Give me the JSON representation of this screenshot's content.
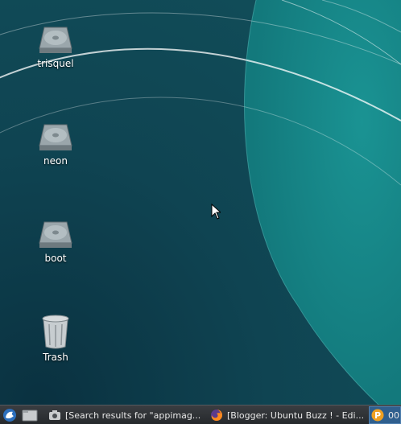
{
  "desktop": {
    "icons": [
      {
        "label": "trisquel",
        "icon": "drive-harddisk-icon"
      },
      {
        "label": "neon",
        "icon": "drive-harddisk-icon"
      },
      {
        "label": "boot",
        "icon": "drive-harddisk-icon"
      },
      {
        "label": "Trash",
        "icon": "trash-icon"
      }
    ]
  },
  "taskbar": {
    "start_icon": "whisker-menu-icon",
    "show_desktop_icon": "show-desktop-icon",
    "tasks": [
      {
        "label": "[Search results for \"appimag...",
        "icon": "screenshot-camera-icon"
      },
      {
        "label": "[Blogger: Ubuntu Buzz ! - Edi...",
        "icon": "firefox-icon"
      },
      {
        "label": "00",
        "icon": "app-p-icon"
      }
    ]
  },
  "colors": {
    "wallpaper_dark": "#0d3f4d",
    "wallpaper_teal": "#168b8b",
    "taskbar_bg": "#2b2e31",
    "active_task": "#2f5f8e"
  }
}
